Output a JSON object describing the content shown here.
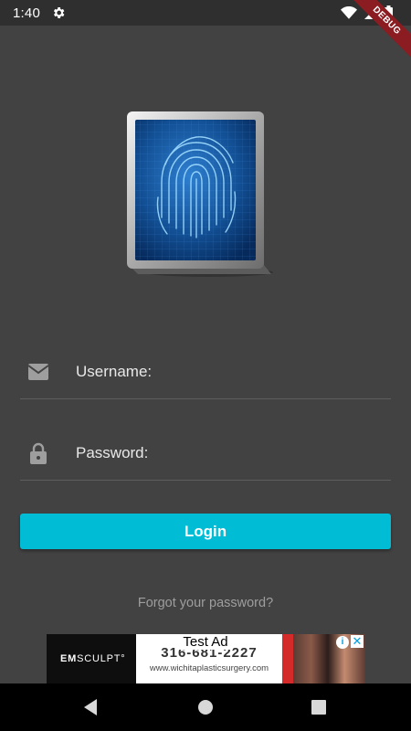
{
  "status_bar": {
    "time": "1:40",
    "icons": [
      "settings-gear-icon",
      "wifi-icon",
      "signal-icon",
      "battery-icon"
    ]
  },
  "debug_banner": "DEBUG",
  "login_form": {
    "logo": "fingerprint-scanner-logo",
    "username_label": "Username:",
    "password_label": "Password:",
    "login_label": "Login",
    "forgot_label": "Forgot your password?"
  },
  "ad": {
    "tag": "Test Ad",
    "brand_prefix": "EM",
    "brand_suffix": "SCULPT°",
    "phone": "316-681-2227",
    "url": "www.wichitaplasticsurgery.com"
  },
  "colors": {
    "background": "#424242",
    "accent": "#00bcd4",
    "status_bar": "#2f2f2f",
    "debug_ribbon": "#8b1d22"
  },
  "nav_bar": {
    "buttons": [
      "back-icon",
      "home-icon",
      "recents-icon"
    ]
  }
}
